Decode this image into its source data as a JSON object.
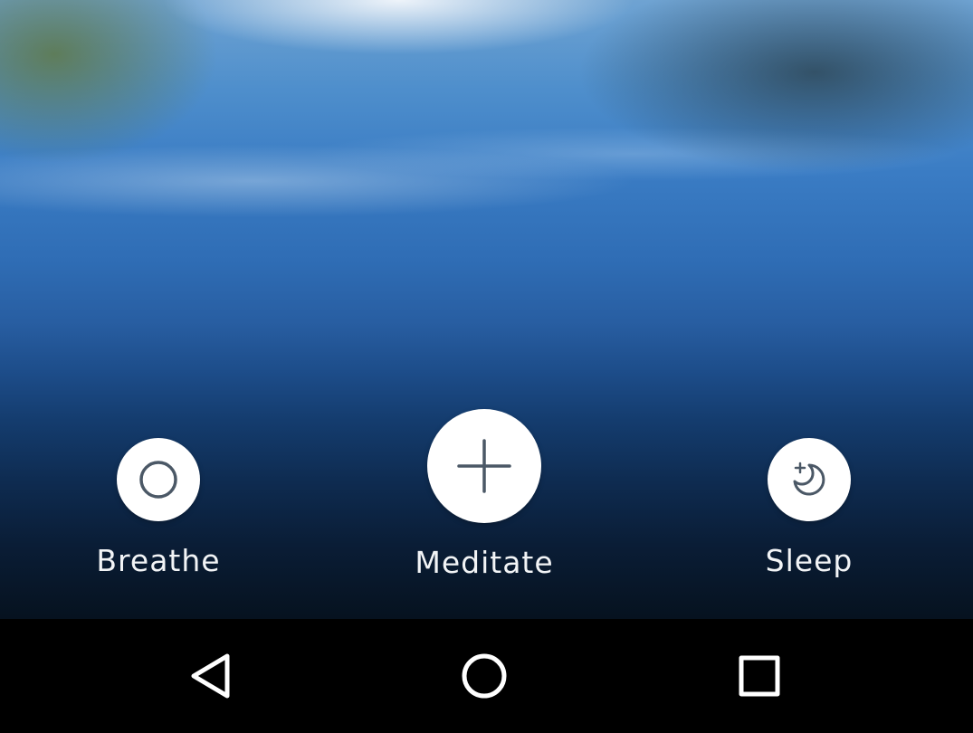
{
  "actions": {
    "breathe": {
      "label": "Breathe",
      "icon": "circle-outline-icon"
    },
    "meditate": {
      "label": "Meditate",
      "icon": "plus-icon"
    },
    "sleep": {
      "label": "Sleep",
      "icon": "moon-star-icon"
    }
  },
  "navigation": {
    "back": "back-triangle-icon",
    "home": "home-circle-icon",
    "recents": "recents-square-icon"
  },
  "colors": {
    "icon_stroke": "#4b5866",
    "label_text": "#f2f4f6",
    "nav_icon": "#ffffff"
  }
}
